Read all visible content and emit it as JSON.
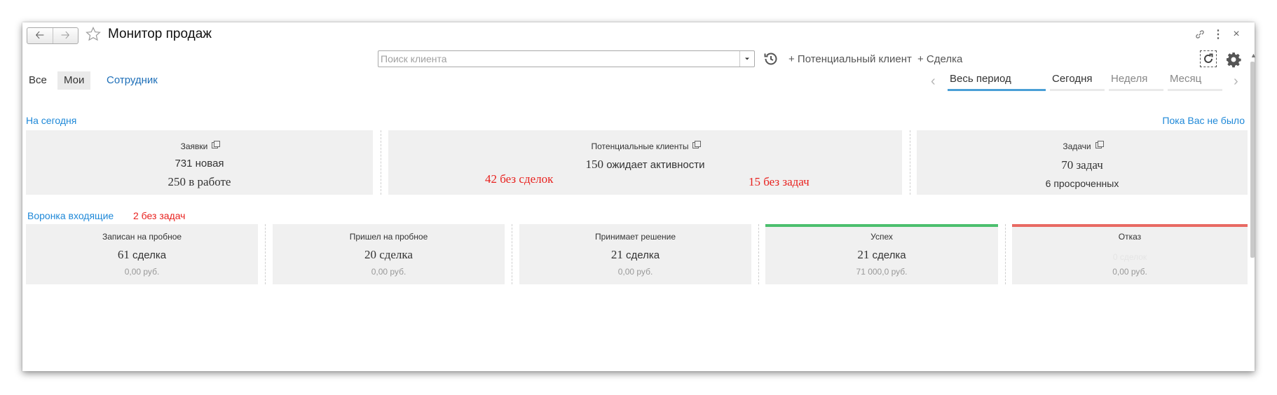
{
  "window": {
    "title": "Монитор продаж"
  },
  "toolbar": {
    "search_placeholder": "Поиск клиента",
    "search_value": "",
    "add_lead_label": "+ Потенциальный клиент",
    "add_deal_label": "+ Сделка"
  },
  "filters": {
    "tabs": [
      {
        "label": "Все",
        "active": false
      },
      {
        "label": "Мои",
        "active": true
      },
      {
        "label": "Сотрудник",
        "active": false
      }
    ]
  },
  "periods": {
    "items": [
      {
        "label": "Весь период",
        "selected": true
      },
      {
        "label": "Сегодня",
        "selected": false
      },
      {
        "label": "Неделя",
        "selected": false
      },
      {
        "label": "Месяц",
        "selected": false
      }
    ]
  },
  "today": {
    "heading": "На сегодня",
    "since_link": "Пока Вас не было",
    "requests": {
      "title": "Заявки",
      "new_num": "731",
      "new_label": "новая",
      "in_work": "250 в работе"
    },
    "leads": {
      "title": "Потенциальные клиенты",
      "waiting_num": "150",
      "waiting_label": "ожидает активности",
      "no_deals": "42 без сделок",
      "no_tasks": "15 без задач"
    },
    "tasks": {
      "title": "Задачи",
      "count": "70 задач",
      "overdue": "6 просроченных"
    }
  },
  "funnel": {
    "heading": "Воронка входящие",
    "no_tasks": "2 без задач",
    "stages": [
      {
        "title": "Записан на пробное",
        "num": "61",
        "label": "сделка",
        "sum": "0,00 руб."
      },
      {
        "title": "Пришел на пробное",
        "num": "20",
        "label": "сделка",
        "sum": "0,00 руб."
      },
      {
        "title": "Принимает решение",
        "num": "21",
        "label": "сделка",
        "sum": "0,00 руб."
      },
      {
        "title": "Успех",
        "num": "21",
        "label": "сделка",
        "sum": "71 000,0 руб."
      },
      {
        "title": "Отказ",
        "num": "",
        "label": "0 сделок",
        "sum": "0,00 руб."
      }
    ]
  },
  "colors": {
    "accent_blue": "#1e88d8",
    "alert_red": "#e8211e",
    "success_green": "#4cbf6e",
    "fail_red": "#e86a63"
  },
  "icons": [
    "back-arrow-icon",
    "forward-arrow-icon",
    "star-icon",
    "link-icon",
    "more-icon",
    "close-icon",
    "dropdown-arrow-icon",
    "history-icon",
    "refresh-icon",
    "gear-icon",
    "chevron-left-icon",
    "chevron-right-icon",
    "open-external-icon"
  ]
}
